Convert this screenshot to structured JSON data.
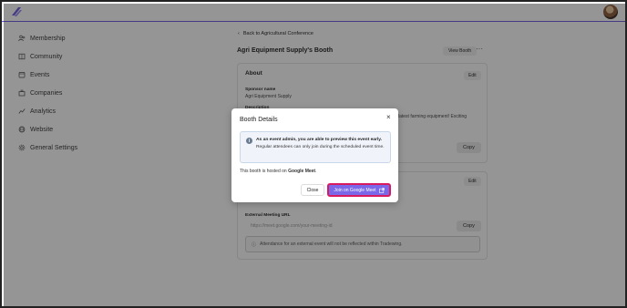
{
  "sidebar": {
    "items": [
      {
        "label": "Membership",
        "icon": "users-icon"
      },
      {
        "label": "Community",
        "icon": "book-icon"
      },
      {
        "label": "Events",
        "icon": "calendar-icon"
      },
      {
        "label": "Companies",
        "icon": "building-icon"
      },
      {
        "label": "Analytics",
        "icon": "chart-icon"
      },
      {
        "label": "Website",
        "icon": "globe-icon"
      },
      {
        "label": "General Settings",
        "icon": "gear-icon"
      }
    ]
  },
  "main": {
    "back_label": "Back to Agricultural Conference",
    "booth_title": "Agri Equipment Supply's Booth",
    "view_booth_label": "View Booth",
    "more_label": "···",
    "about": {
      "title": "About",
      "edit_label": "Edit",
      "sponsor_name_label": "Sponsor name",
      "sponsor_name_value": "Agri Equipment Supply",
      "description_label": "Description",
      "description_value_tail": "latest farming equipment! Exciting",
      "copy_label": "Copy"
    },
    "meeting": {
      "edit_label": "Edit",
      "url_label": "External Meeting URL",
      "url_placeholder": "https://meet.google.com/your-meeting-id",
      "copy_label": "Copy",
      "note": "Attendance for an external event will not be reflected within Tradewing."
    }
  },
  "modal": {
    "title": "Booth Details",
    "close_symbol": "×",
    "info_bold": "As an event admin, you are able to preview this event early.",
    "info_rest": " Regular attendees can only join during the scheduled event time.",
    "hosted_prefix": "This booth is hosted on ",
    "hosted_platform": "Google Meet",
    "hosted_suffix": ".",
    "close_label": "Close",
    "join_label": "Join on Google Meet"
  },
  "colors": {
    "accent": "#7b68e8",
    "highlight_border": "#d81b60",
    "topbar_line": "#6c5ce0"
  }
}
